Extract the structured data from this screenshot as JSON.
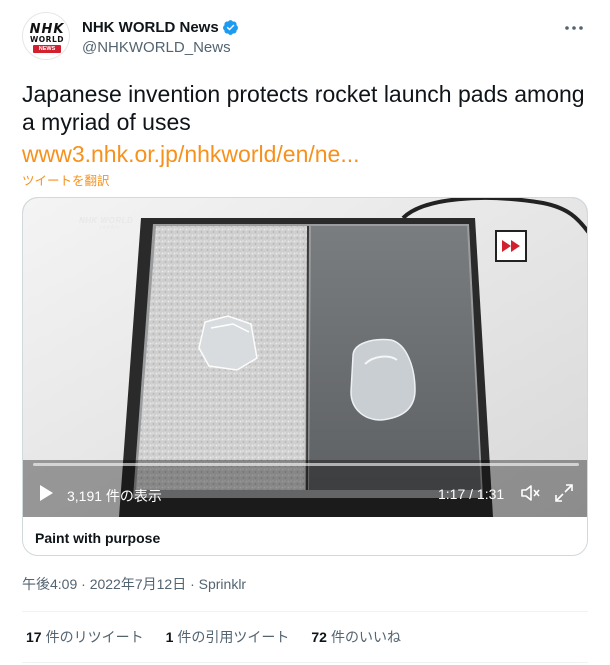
{
  "account": {
    "display_name": "NHK WORLD News",
    "handle": "@NHKWORLD_News",
    "verified": true,
    "avatar_text": {
      "top": "NHK",
      "middle": "WORLD",
      "badge": "NEWS"
    },
    "more_icon": "more-horizontal-icon"
  },
  "tweet": {
    "text": "Japanese invention protects rocket launch pads among a myriad of uses",
    "link": "www3.nhk.or.jp/nhkworld/en/ne...",
    "translate": "ツイートを翻訳"
  },
  "media": {
    "watermark": "NHK WORLD",
    "watermark_sub": "JAPAN",
    "views": "3,191 件の表示",
    "time": "1:17 / 1:31",
    "progress": 0,
    "icons": {
      "play": "play-icon",
      "volume": "volume-muted-icon",
      "fullscreen": "fullscreen-icon",
      "fast_forward": "fast-forward-icon"
    },
    "card_title": "Paint with purpose"
  },
  "meta": {
    "time_date_source": "午後4:09 · 2022年7月12日 · Sprinklr"
  },
  "stats": [
    {
      "count": "17",
      "label": "件のリツイート"
    },
    {
      "count": "1",
      "label": "件の引用ツイート"
    },
    {
      "count": "72",
      "label": "件のいいね"
    }
  ],
  "colors": {
    "accent": "#f7911d",
    "verified": "#1d9bf0",
    "secondary_text": "#536471",
    "ff_badge": "#d3202e"
  }
}
